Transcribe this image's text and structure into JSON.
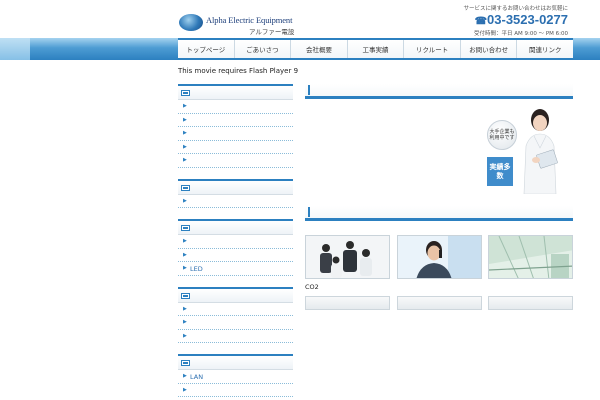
{
  "header": {
    "logo_title": "Alpha Electric Equipment",
    "logo_subtitle": "アルファー電設",
    "contact_note": "サービスに関するお問い合わせはお気軽に",
    "phone_icon": "telephone-icon",
    "phone": "03-3523-0277",
    "hours": "受付時間：平日 AM 9:00 〜 PM 6:00"
  },
  "nav": {
    "items": [
      {
        "label": "トップページ"
      },
      {
        "label": "ごあいさつ"
      },
      {
        "label": "会社概要"
      },
      {
        "label": "工事実績"
      },
      {
        "label": "リクルート"
      },
      {
        "label": "お問い合わせ"
      },
      {
        "label": "関連リンク"
      }
    ]
  },
  "flash_notice": "This movie requires Flash Player 9",
  "sidebar": {
    "groups": [
      {
        "items": [
          "",
          "",
          "",
          "",
          ""
        ]
      },
      {
        "items": [
          ""
        ]
      },
      {
        "items": [
          "",
          "",
          "LED"
        ]
      },
      {
        "items": [
          "",
          "",
          ""
        ]
      },
      {
        "items": [
          "LAN",
          "",
          ""
        ]
      }
    ]
  },
  "hero": {
    "bubble_text": "大手企業も利用中です",
    "badge_text": "実績多数"
  },
  "main": {
    "caption": "CO2"
  },
  "colors": {
    "accent": "#2c80c0",
    "link": "#2c6fb0",
    "badge": "#3f8ccb"
  }
}
